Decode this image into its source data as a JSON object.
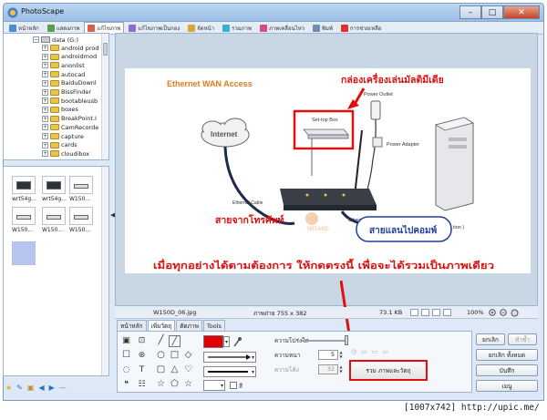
{
  "window": {
    "title": "PhotoScape",
    "minimize_glyph": "–",
    "maximize_glyph": "□",
    "close_glyph": "✕"
  },
  "tabs": [
    {
      "label": "หน้าหลัก",
      "icon": "home-icon",
      "color": "#4a8cd8"
    },
    {
      "label": "แสดงภาพ",
      "icon": "viewer-icon",
      "color": "#5aa04a"
    },
    {
      "label": "แก้ไขภาพ",
      "icon": "editor-icon",
      "color": "#d8604a",
      "active": true
    },
    {
      "label": "แก้ไขภาพเป็นกอง",
      "icon": "batch-icon",
      "color": "#8f6ad0"
    },
    {
      "label": "จัดหน้า",
      "icon": "page-icon",
      "color": "#d8a73a"
    },
    {
      "label": "รวมภาพ",
      "icon": "combine-icon",
      "color": "#3aaed8"
    },
    {
      "label": "ภาพเคลื่อนไหว",
      "icon": "gif-icon",
      "color": "#d84a8c"
    },
    {
      "label": "พิมพ์",
      "icon": "print-icon",
      "color": "#6a8fb0"
    },
    {
      "label": "การช่วยเหลือ",
      "icon": "help-icon",
      "color": "#e03030"
    }
  ],
  "tree": {
    "expander_collapsed": "+",
    "expander_expanded": "−",
    "root": "data (G:)",
    "folders": [
      "android prod",
      "androidmod",
      "anonlist",
      "autocad",
      "BaiduDownl",
      "BissFinder",
      "bootableusb",
      "boxes",
      "BreakPoint.I",
      "CamRecorde",
      "capture",
      "cards",
      "cloudibox"
    ]
  },
  "thumbnails": [
    {
      "label": "wrt54g..."
    },
    {
      "label": "wrt54g..."
    },
    {
      "label": "W150..."
    },
    {
      "label": "W150..."
    },
    {
      "label": "W150..."
    },
    {
      "label": "W150..."
    },
    {
      "label": ""
    }
  ],
  "splitter_arrow": "◀",
  "left_tool_glyphs": [
    "★",
    "✎",
    "▣",
    "◀",
    "▶",
    "—"
  ],
  "photo": {
    "heading": "Ethernet WAN Access",
    "annotation_top": "กล่องเครื่องเล่นมัลติมีเดีย",
    "power_outlet": "Power Outlet",
    "set_top_box": "Set-top Box",
    "power_adapter": "Power Adapter",
    "internet": "Internet",
    "ethernet_cable_left": "Ethernet Cable",
    "ethernet_cable_right": "Ethernet Cable",
    "phone_line": "สายจากโทรศัพท์",
    "lan_to_pc": "สายแลนไปคอมพ์",
    "partial_text": "tion )",
    "watermark_logo": "WIZARD",
    "instruction": "เมื่อทุกอย่างได้ตามต้องการ ให้กดตรงนี้ เพื่อจะได้รวมเป็นภาพเดียว"
  },
  "infobar": {
    "filename": "W150D_06.jpg",
    "dimensions": "ภาพถ่าย 755 x 382",
    "filesize": "73.1 KB",
    "zoom": "100%"
  },
  "edit_tabs": [
    "หน้าหลัก",
    "เพิ่มวัตถุ",
    "ตัดภาพ",
    "Tools"
  ],
  "tools": {
    "transparency_label": "ความโปร่งใส",
    "thickness_label": "ความหนา",
    "thickness_value": "5",
    "roundness_label": "ความโค้ง",
    "roundness_value": "32",
    "fill_label": "สี",
    "merge_button": "รวม ภาพและวัตถุ",
    "swatch_color": "#e10000"
  },
  "right_buttons": {
    "undo": "ยกเลิก",
    "redo": "ทำซ้ำ",
    "undo_all": "ยกเลิก ทั้งหมด",
    "save": "บันทึก",
    "menu": "เมนู"
  },
  "footer_watermark": "[1007x742]  http://upic.me/"
}
